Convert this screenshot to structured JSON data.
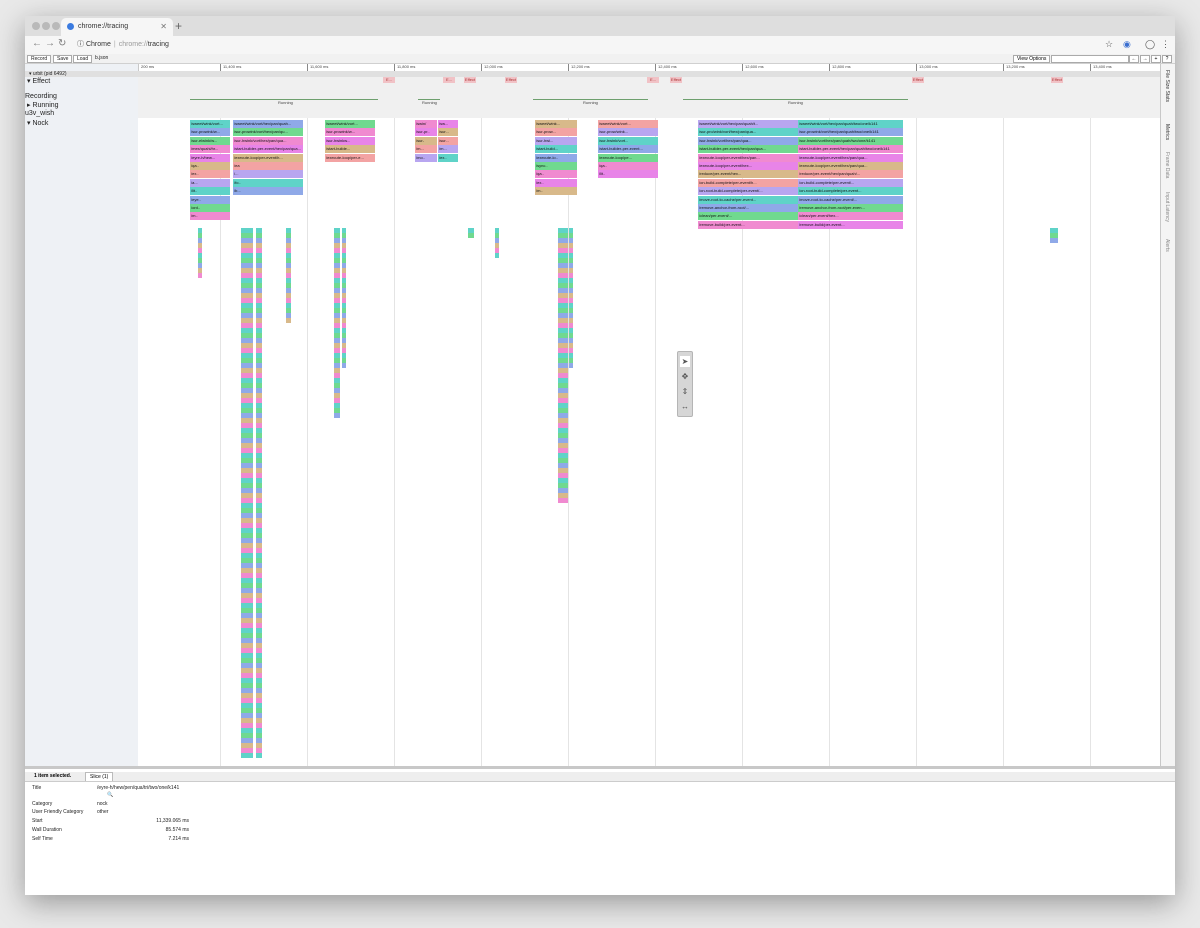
{
  "browser": {
    "tab_title": "chrome://tracing",
    "url_scheme_label": "Chrome",
    "url_scheme": "chrome://",
    "url_path": "tracing"
  },
  "toolbar": {
    "record": "Record",
    "save": "Save",
    "load": "Load",
    "file_name": "b.json",
    "view_options": "View Options",
    "search_placeholder": "",
    "prev_arrow": "←",
    "next_arrow": "→",
    "expand": "+",
    "help": "?"
  },
  "ruler": {
    "ticks": [
      "200 ms",
      "11,400 ms",
      "11,600 ms",
      "11,800 ms",
      "12,000 ms",
      "12,200 ms",
      "12,400 ms",
      "12,600 ms",
      "12,800 ms",
      "13,000 ms",
      "13,200 ms",
      "13,400 ms"
    ]
  },
  "sidebar": {
    "process": "urbit (pid 6492)",
    "effect": "Effect",
    "recording": "Recording",
    "running": "Running",
    "u3v_wish": "u3v_wish",
    "nock": "Nock"
  },
  "effects": {
    "labels": [
      "E...",
      "E...",
      "Effect",
      "Effect",
      "E...",
      "Effect",
      "Effect",
      "Effect"
    ]
  },
  "running": {
    "labels": [
      "Running",
      "Running",
      "Running",
      "Running"
    ]
  },
  "slices": {
    "c1": [
      "/sweet/wink/vort...",
      "/sur-prowink/w...",
      "/sur-elwink/w...",
      "/mex/quahi/hr...",
      "/eyre-h/hew...",
      "/qa..",
      "/ex..",
      "/a...",
      "/lit..",
      "/eye..",
      "/ord..",
      "/m.."
    ],
    "c2": [
      "/sweet/wink/vort/hex/pan/quah...",
      "/sur-prowink/vort/hex/pan/qu...",
      "/sur-hwink/vort/hex/pan/qua...",
      "/start-builder-per-event/hex/pan/qua...",
      "/execute-loop/per-event/h...",
      "/ea",
      "/...",
      "/fo..",
      "/b..."
    ],
    "c3": [
      "/sweet/wink/vort...",
      "/sur-prowink/w...",
      "/sur-hwinkw...",
      "/start-builde...",
      "/execute-loop/per-e..."
    ],
    "c4": [
      "/swin/",
      "/sur-pr..",
      "/sur-",
      "/m...",
      "/mo.."
    ],
    "c5": [
      "/sw...",
      "/sur...",
      "/sur...",
      "/m...",
      "/ex.."
    ],
    "c6": [
      "/sweet/wink...",
      "/sur-prow...",
      "/sur-hwi...",
      "/start-build...",
      "/execute-lo..",
      "/sync..",
      "/qa..",
      "/ex..",
      "/m.."
    ],
    "c7": [
      "/sweet/wink/vort...",
      "/sur-prow/wink...",
      "/sur-hwink/vort...",
      "/start-builder-per-event...",
      "/execute-loop/pe...",
      "/qa..",
      "/lit.."
    ],
    "c8": [
      "/sweet/wink/vort/hex/pan/quah/t...",
      "/sur-pro/wink/vort/hex/pan/qua...",
      "/sur-hwink/vort/hex/pan/qua...",
      "/start-builder-per-event/hex/pan/qua...",
      "/execute-loop/per-event/hex/pan...",
      "/execute-loop/per-event/hex...",
      "/reduce/per-event/hex...",
      "/on-build-complete/per-event/h...",
      "/on-root-build-complete/per-event/...",
      "/move-root-to-cache/per-event...",
      "/remove-anchor-from-root/...",
      "/clean/per-event/...",
      "/remove-build/per-event..."
    ],
    "c9": [
      "/sweet/wink/vort/hex/pan/quah/two/one/k141",
      "/sur-prowink/vort/hex/pan/quah/two/one/k141",
      "/sur-hwink/vort/hex/pan/quah/two/one/k141",
      "/start-builder-per-event/hex/pan/quah/two/one/k141",
      "/execute-loop/per-event/hex/pan/qua...",
      "/execute-loop/per-event/hex/pan/qua...",
      "/reduce/per-event/hex/pan/quah/...",
      "/on-build-complete/per-event/...",
      "/on-root-build-complete/per-event...",
      "/move-root-to-cache/per-event/...",
      "/remove-anchor-from-root/per-even...",
      "/clean/per-event/hex...",
      "/remove-build/per-event..."
    ]
  },
  "panel_tabs": [
    "File Size Stats",
    "Metrics",
    "Frame Data",
    "Input Latency",
    "Alerts"
  ],
  "analysis": {
    "selected": "1 item selected.",
    "tab": "Slice (1)",
    "rows": [
      {
        "label": "Title",
        "value": "/eyre-h/hew/pen/qua/tri/two/one/k141"
      },
      {
        "label": "Category",
        "value": "nock"
      },
      {
        "label": "User Friendly Category",
        "value": "other"
      },
      {
        "label": "Start",
        "value": "11,339.065 ms"
      },
      {
        "label": "Wall Duration",
        "value": "85.574 ms"
      },
      {
        "label": "Self Time",
        "value": "7.214 ms"
      }
    ]
  },
  "colors": {
    "teal": "#5fd3c8",
    "blue": "#8fa9e8",
    "green": "#70d98f",
    "pink": "#f08ad0",
    "magenta": "#e884e8",
    "tan": "#d8b98a",
    "salmon": "#f3a3a3",
    "lavender": "#b8a6f0"
  }
}
